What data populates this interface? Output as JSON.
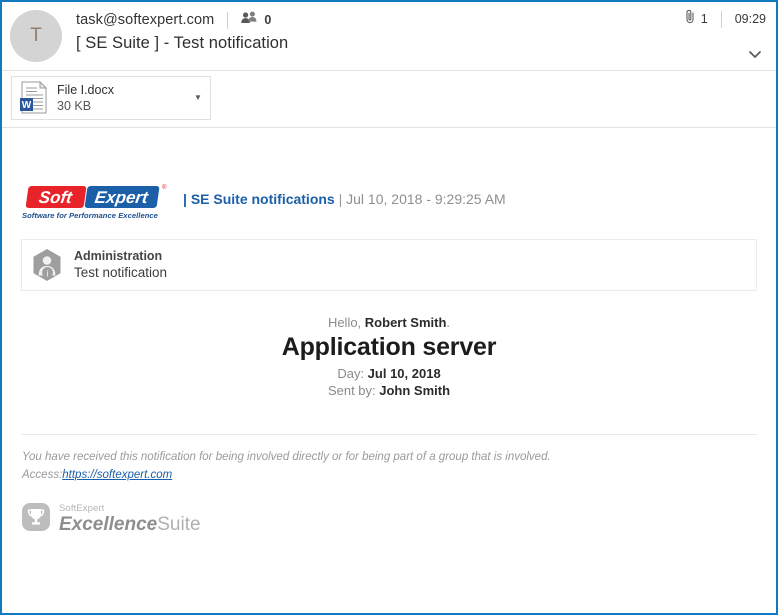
{
  "window": {
    "border_color": "#1079bf"
  },
  "header": {
    "avatar_initial": "T",
    "sender": "task@softexpert.com",
    "people_icon": "people-icon",
    "people_count": "0",
    "subject": "[ SE Suite ] - Test notification",
    "attachment_icon": "paperclip-icon",
    "attachment_count": "1",
    "time": "09:29",
    "expand_icon": "chevron-down-icon"
  },
  "attachment": {
    "icon": "word-document-icon",
    "name": "File I.docx",
    "size": "30 KB",
    "menu_icon": "caret-down-icon"
  },
  "email": {
    "brand": {
      "logo_icon": "softexpert-logo",
      "logo_soft": "Soft",
      "logo_expert": "Expert",
      "logo_registered": "®",
      "logo_tagline": "Software for Performance Excellence",
      "pipe_left": "|",
      "title": "SE Suite notifications",
      "pipe_right": "|",
      "date": "Jul 10, 2018 - 9:29:25 AM"
    },
    "notification": {
      "icon": "user-info-hexagon-icon",
      "module": "Administration",
      "subject": "Test notification"
    },
    "message": {
      "greeting_prefix": "Hello, ",
      "greeting_name": "Robert Smith",
      "greeting_suffix": ".",
      "headline": "Application server",
      "day_label": "Day: ",
      "day_value": "Jul 10, 2018",
      "sent_by_label": "Sent by: ",
      "sent_by_value": "John Smith"
    },
    "footer": {
      "disclaimer": "You have received this notification for being involved directly or for being part of a group that is involved.",
      "access_label": "Access:",
      "access_link": "https://softexpert.com",
      "suite_logo_icon": "excellence-suite-trophy-icon",
      "suite_small": "SoftExpert",
      "suite_bold": "Excellence",
      "suite_light": "Suite"
    }
  }
}
